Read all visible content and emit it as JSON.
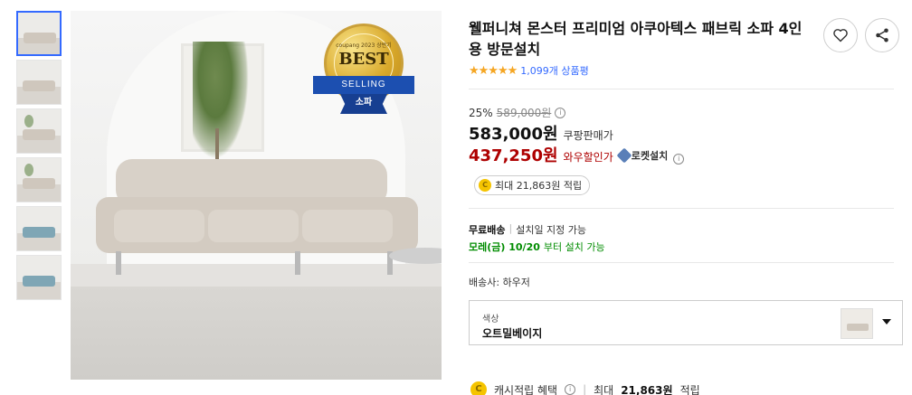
{
  "product": {
    "title": "웰퍼니쳐 몬스터 프리미엄 아쿠아텍스 패브릭 소파 4인용 방문설치",
    "rating_stars": "★★★★★",
    "rating_count": "1,099개 상품평"
  },
  "badge": {
    "top_text": "coupang 2023 상반기",
    "best": "BEST",
    "selling": "SELLING",
    "category": "소파",
    "colors": {
      "gold": "#d9a92b",
      "ribbon": "#1c4fb0"
    }
  },
  "pricing": {
    "discount_rate": "25%",
    "original_price": "589,000원",
    "info_symbol": "i",
    "coupang_price": "583,000원",
    "coupang_label": "쿠팡판매가",
    "wow_price": "437,250원",
    "wow_label": "와우할인가",
    "rocket_label": "로켓설치",
    "accent_red": "#ae0000"
  },
  "reward": {
    "coin_symbol": "C",
    "text": "최대 21,863원 적립"
  },
  "shipping": {
    "free_label": "무료배송",
    "separator": "|",
    "install_note": "설치일 지정 가능",
    "arrival_date": "모레(금) 10/20",
    "arrival_suffix": "부터 설치 가능",
    "seller_label": "배송사: 하우저",
    "accent_green": "#008c00"
  },
  "option": {
    "label": "색상",
    "value": "오트밀베이지"
  },
  "cashback": {
    "label": "캐시적립 혜택",
    "separator": "|",
    "max_label": "최대",
    "amount": "21,863원",
    "suffix": "적립"
  },
  "icons": {
    "wishlist": "heart-icon",
    "share": "share-icon",
    "dropdown": "chevron-down-icon"
  },
  "thumbnails": [
    "thumb-1",
    "thumb-2",
    "thumb-3",
    "thumb-4",
    "thumb-5",
    "thumb-6"
  ]
}
